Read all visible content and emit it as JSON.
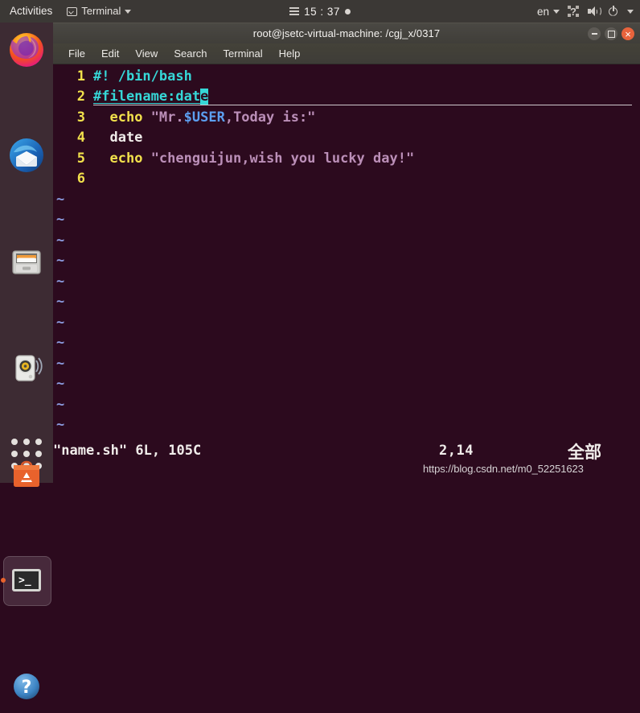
{
  "topbar": {
    "activities": "Activities",
    "app_menu": "Terminal",
    "app_menu_icon": "terminal-icon",
    "calendar_icon": "hamburger-icon",
    "clock": "15 : 37",
    "notification_dot": "notification-dot",
    "language": "en",
    "tray_icons": [
      "accessibility-icon",
      "volume-icon",
      "power-icon",
      "chevron-down-icon"
    ]
  },
  "dock": {
    "items": [
      {
        "name": "firefox",
        "label": "Firefox Web Browser",
        "active": false
      },
      {
        "name": "thunderbird",
        "label": "Thunderbird Mail",
        "active": false
      },
      {
        "name": "files",
        "label": "Files",
        "active": false
      },
      {
        "name": "rhythmbox",
        "label": "Rhythmbox",
        "active": false
      },
      {
        "name": "ubuntu-software",
        "label": "Ubuntu Software",
        "active": false
      },
      {
        "name": "terminal",
        "label": "Terminal",
        "active": true
      },
      {
        "name": "help",
        "label": "Help",
        "active": false
      }
    ],
    "show_applications": "Show Applications"
  },
  "window": {
    "title": "root@jsetc-virtual-machine: /cgj_x/0317",
    "controls": {
      "minimize": "minimize",
      "maximize": "maximize",
      "close": "close"
    },
    "menu": [
      "File",
      "Edit",
      "View",
      "Search",
      "Terminal",
      "Help"
    ]
  },
  "editor": {
    "lines": [
      {
        "number": "1",
        "segments": [
          {
            "text": "#! /bin/bash",
            "color": "cyan"
          }
        ]
      },
      {
        "number": "2",
        "segments": [
          {
            "text": "#filename:dat",
            "color": "cyan-underline"
          },
          {
            "text": "e",
            "color": "cursor"
          }
        ]
      },
      {
        "number": "3",
        "segments": [
          {
            "text": "  ",
            "color": "white"
          },
          {
            "text": "echo",
            "color": "yellow"
          },
          {
            "text": " ",
            "color": "white"
          },
          {
            "text": "\"Mr.",
            "color": "pink"
          },
          {
            "text": "$USER",
            "color": "blue"
          },
          {
            "text": ",Today is:\"",
            "color": "pink"
          }
        ]
      },
      {
        "number": "4",
        "segments": [
          {
            "text": "  date",
            "color": "white"
          }
        ]
      },
      {
        "number": "5",
        "segments": [
          {
            "text": "  ",
            "color": "white"
          },
          {
            "text": "echo",
            "color": "yellow"
          },
          {
            "text": " ",
            "color": "white"
          },
          {
            "text": "\"chenguijun,wish you lucky day!\"",
            "color": "pink"
          }
        ]
      },
      {
        "number": "6",
        "segments": []
      }
    ],
    "empty_marker": "~",
    "empty_marker_count": 12,
    "status": {
      "file": "\"name.sh\" 6L, 105C",
      "position": "2,14",
      "percent": "全部"
    },
    "watermark": "https://blog.csdn.net/m0_52251623"
  },
  "colors": {
    "terminal_bg": "#2c0a1e",
    "topbar_bg": "#3b3835",
    "dock_bg": "#3d2b33",
    "titlebar_bg": "#46443f",
    "cursor": "#36d7d7",
    "linenumber": "#f2e14c",
    "tilde": "#8c9ce0",
    "accent_close": "#e8633c"
  }
}
